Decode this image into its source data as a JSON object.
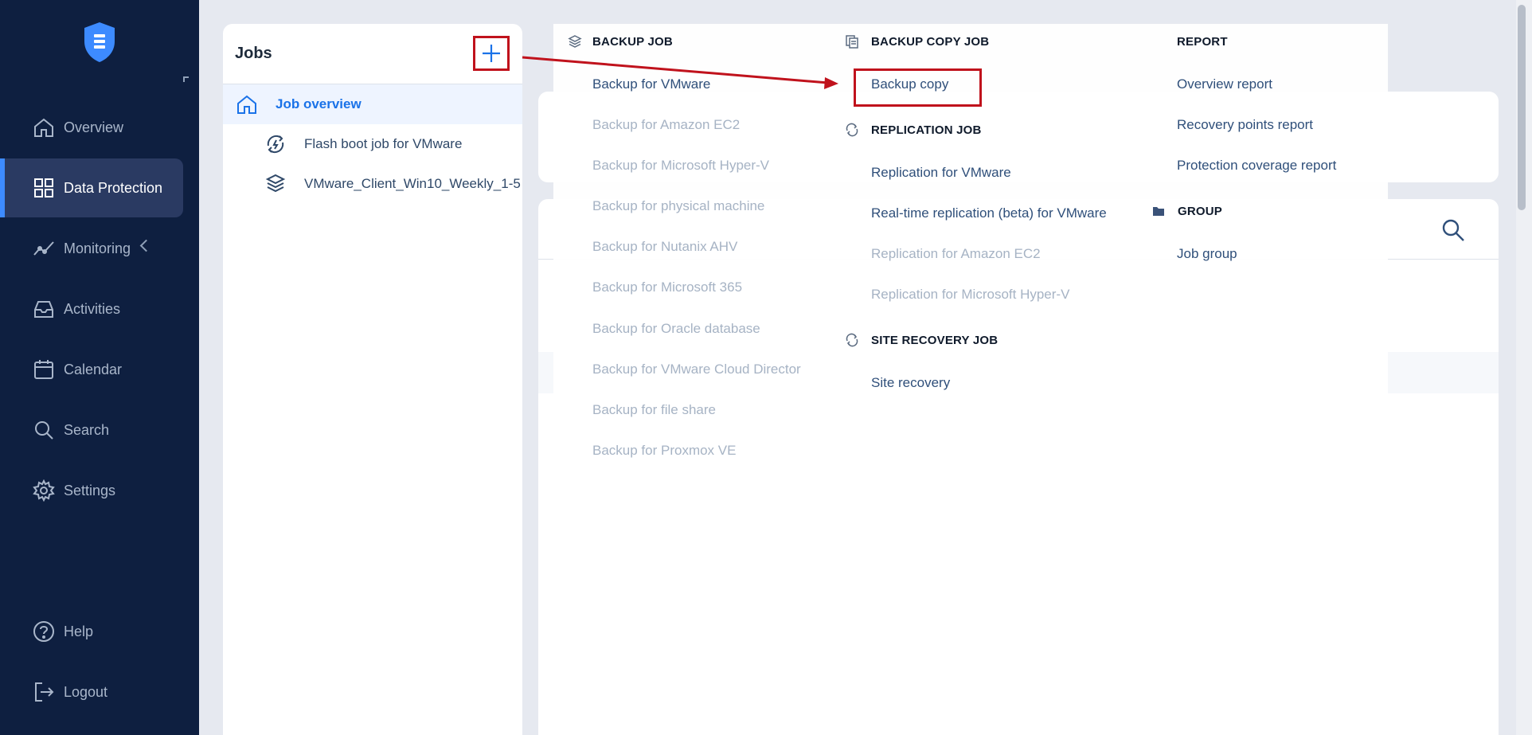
{
  "sidebar": {
    "items": [
      {
        "label": "Overview",
        "icon": "home-icon"
      },
      {
        "label": "Data Protection",
        "icon": "grid-icon",
        "active": true
      },
      {
        "label": "Monitoring",
        "icon": "chart-icon"
      },
      {
        "label": "Activities",
        "icon": "inbox-icon"
      },
      {
        "label": "Calendar",
        "icon": "calendar-icon"
      },
      {
        "label": "Search",
        "icon": "search-icon"
      },
      {
        "label": "Settings",
        "icon": "gear-icon"
      }
    ],
    "bottom_items": [
      {
        "label": "Help",
        "icon": "help-icon"
      },
      {
        "label": "Logout",
        "icon": "logout-icon"
      }
    ]
  },
  "jobs_panel": {
    "title": "Jobs",
    "rows": [
      {
        "label": "Job overview",
        "icon": "home-icon"
      },
      {
        "label": "Flash boot job for VMware",
        "icon": "flash-boot-icon"
      },
      {
        "label": "VMware_Client_Win10_Weekly_1-5",
        "icon": "backup-job-icon"
      }
    ]
  },
  "menu": {
    "backup_job": {
      "header": "BACKUP JOB",
      "items": [
        {
          "label": "Backup for VMware",
          "enabled": true
        },
        {
          "label": "Backup for Amazon EC2",
          "enabled": false
        },
        {
          "label": "Backup for Microsoft Hyper-V",
          "enabled": false
        },
        {
          "label": "Backup for physical machine",
          "enabled": false
        },
        {
          "label": "Backup for Nutanix AHV",
          "enabled": false
        },
        {
          "label": "Backup for Microsoft 365",
          "enabled": false
        },
        {
          "label": "Backup for Oracle database",
          "enabled": false
        },
        {
          "label": "Backup for VMware Cloud Director",
          "enabled": false
        },
        {
          "label": "Backup for file share",
          "enabled": false
        },
        {
          "label": "Backup for Proxmox VE",
          "enabled": false
        }
      ]
    },
    "backup_copy_job": {
      "header": "BACKUP COPY JOB",
      "items": [
        {
          "label": "Backup copy",
          "enabled": true
        }
      ]
    },
    "replication_job": {
      "header": "REPLICATION JOB",
      "items": [
        {
          "label": "Replication for VMware",
          "enabled": true
        },
        {
          "label": "Real-time replication (beta) for VMware",
          "enabled": true
        },
        {
          "label": "Replication for Amazon EC2",
          "enabled": false
        },
        {
          "label": "Replication for Microsoft Hyper-V",
          "enabled": false
        }
      ]
    },
    "site_recovery_job": {
      "header": "SITE RECOVERY JOB",
      "items": [
        {
          "label": "Site recovery",
          "enabled": true
        }
      ]
    },
    "report": {
      "header": "REPORT",
      "items": [
        {
          "label": "Overview report",
          "enabled": true
        },
        {
          "label": "Recovery points report",
          "enabled": true
        },
        {
          "label": "Protection coverage report",
          "enabled": true
        }
      ]
    },
    "group": {
      "header": "GROUP",
      "items": [
        {
          "label": "Job group",
          "enabled": true
        }
      ]
    }
  },
  "colors": {
    "sidebar_bg": "#0e1f40",
    "active_accent": "#3d8bff",
    "annotation_red": "#c0121c",
    "link_blue": "#2f4f7a",
    "disabled_gray": "#a6b3c4"
  }
}
